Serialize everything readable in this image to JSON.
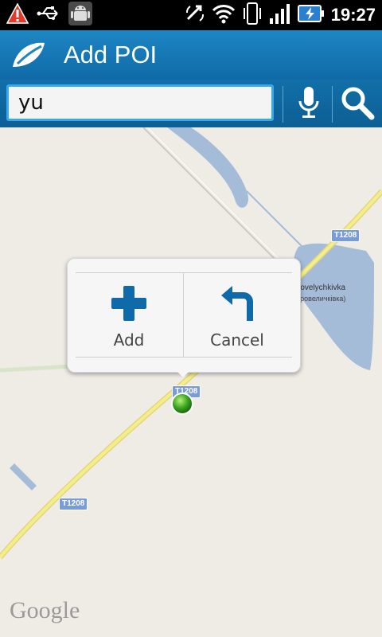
{
  "status_bar": {
    "time": "19:27",
    "icons": [
      "warning-icon",
      "usb-icon",
      "android-debug-icon",
      "sync-icon",
      "wifi-icon",
      "vibrate-icon",
      "signal-icon",
      "battery-charging-icon"
    ]
  },
  "header": {
    "title": "Add POI",
    "logo": "app-logo"
  },
  "search": {
    "value": "yu",
    "mic_icon": "mic-icon",
    "search_icon": "search-icon"
  },
  "map": {
    "road_labels": [
      "T1208",
      "T1208",
      "T1208"
    ],
    "place_name": "rovelychkivka",
    "place_name_alt": "бровеличківка)",
    "attribution": "Google"
  },
  "popup": {
    "add_label": "Add",
    "cancel_label": "Cancel"
  },
  "colors": {
    "header": "#1e86c4",
    "search_border": "#34a9f0",
    "icon_blue": "#0e6aa8",
    "marker": "#3ba51f",
    "water": "#a4bcd8",
    "road": "#f4ee8a"
  }
}
